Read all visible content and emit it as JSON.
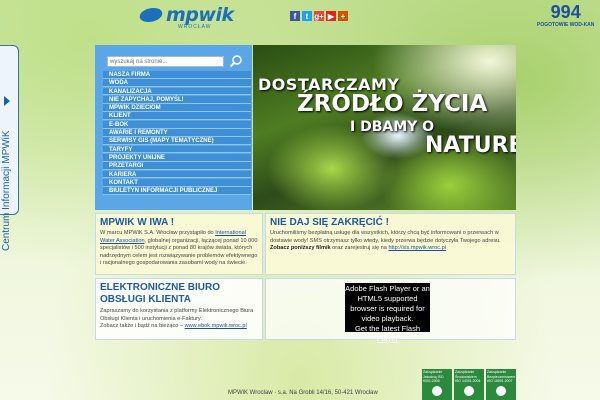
{
  "header": {
    "logo_text": "mpwik",
    "logo_sub": "WROCŁAW",
    "social": [
      "f",
      "t",
      "g+",
      "▶",
      "+"
    ],
    "emergency_number": "994",
    "emergency_label": "POGOTOWIE WOD-KAN"
  },
  "side_tab": {
    "label": "Centrum Informacji MPWiK"
  },
  "nav": {
    "search_placeholder": "wyszukaj na stronie...",
    "items": [
      "NASZA FIRMA",
      "WODA",
      "KANALIZACJA",
      "NIE ZAPYCHAJ, POMYŚL!",
      "MPWIK DZIECIOM",
      "KLIENT",
      "E-BOK",
      "AWARIE I REMONTY",
      "SERWISY GIS (MAPY TEMATYCZNE)",
      "TARYFY",
      "PROJEKTY UNIJNE",
      "PRZETARGI",
      "KARIERA",
      "KONTAKT",
      "BIULETYN INFORMACJI PUBLICZNEJ"
    ]
  },
  "hero": {
    "line1": "DOSTARCZAMY",
    "line2": "ŹRÓDŁO ŻYCIA",
    "line3": "I DBAMY O",
    "line4": "NATURĘ"
  },
  "box_iwa": {
    "title": "MPWIK W IWA !",
    "text_pre": "W marcu MPWiK S.A. Wrocław przystąpiło do ",
    "link": "International Water Association",
    "text_post": ", globalnej organizacji, łączącej ponad 10 000 specjalistów i 500 instytucji z ponad 80 krajów świata, których nadrzędnym celem jest rozwiązywanie problemów efektywnego i racjonalnego gospodarowania zasobami wody na świecie."
  },
  "box_sms": {
    "title": "NIE DAJ SIĘ ZAKRĘCIĆ !",
    "text": "Uruchomiliśmy bezpłatną usługę dla wszystkich, którzy chcą być informowani o przerwach w dostawie wody! SMS otrzymasz tylko wtedy, kiedy przerwa będzie dotyczyła Twojego adresu.",
    "bold": "Zobacz poniższy filmik",
    "text2": " oraz zarejestruj się na ",
    "link": "http://sis.mpwik.wroc.pl"
  },
  "box_ebok": {
    "title": "ELEKTRONICZNE BIURO OBSŁUGI KLIENTA",
    "text": "Zapraszamy do korzystania z platformy Elektronicznego Biura Obsługi Klienta i uruchomienia e-Faktury.",
    "text2": "Zobacz także i bądź na bieżąco – ",
    "link": "www.ebok.mpwik.wroc.pl"
  },
  "video": {
    "message": "Adobe Flash Player or an HTML5 supported browser is required for video playback.",
    "link": "Get the latest Flash Player"
  },
  "footer": {
    "text": "MPWiK Wrocław · s.a. Na Grobli 14/16, 50-421 Wrocław"
  },
  "certs": [
    "Zarządzanie Jakością ISO 9001:2008",
    "Zarządzanie Środowiskiem ISO 14001:2004",
    "Zarządzanie Bezpieczeństwem ISO 18001:2007"
  ],
  "colors": {
    "nav_bg": "#5aa6e6",
    "menu_item": "#3f8fd6",
    "title": "#1e5aa2"
  }
}
